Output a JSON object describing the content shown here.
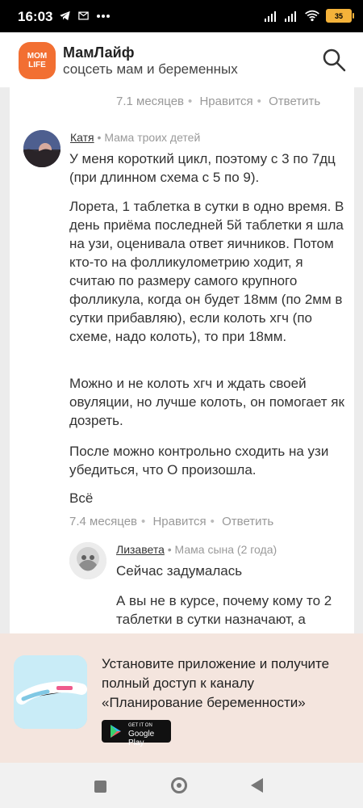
{
  "status_bar": {
    "time": "16:03",
    "left_icons": [
      "telegram-icon",
      "mail-icon",
      "more-dots-icon"
    ],
    "battery": "35"
  },
  "header": {
    "logo_line1": "MOM",
    "logo_line2": "LIFE",
    "title": "МамЛайф",
    "subtitle": "соцсеть мам и беременных"
  },
  "comments": {
    "top_meta": {
      "time": "7.1 месяцев",
      "like": "Нравится",
      "reply": "Ответить"
    },
    "katya": {
      "name": "Катя",
      "role": "Мама троих детей",
      "p1": "У меня короткий цикл, поэтому с 3 по 7дц (при длинном схема с 5 по 9).",
      "p2": "Лорета, 1 таблетка в сутки в одно время. В день приёма последней 5й таблетки я шла на узи, оценивала ответ яичников. Потом кто-то на фолликулометрию ходит, я считаю по размеру самого крупного фолликула, когда он будет 18мм (по 2мм в сутки прибавляю), если колоть хгч (по схеме, надо колоть), то при 18мм.",
      "p3": "Можно и не колоть хгч и ждать своей овуляции, но лучше колоть, он помогает як дозреть.",
      "p4": "После можно контрольно сходить на узи убедиться, что О произошла.",
      "p5": "Всё",
      "meta": {
        "time": "7.4 месяцев",
        "like": "Нравится",
        "reply": "Ответить"
      }
    },
    "lizaveta": {
      "name": "Лизавета",
      "role": "Мама сына (2 года)",
      "p1": "Сейчас задумалась",
      "p2": "А вы не в курсе, почему кому то 2 таблетки в сутки назначают, а"
    }
  },
  "banner": {
    "text": "Установите приложение и получите полный доступ к каналу «Планирование беременности»",
    "store_small": "GET IT ON",
    "store_big": "Google Play"
  },
  "nav": {
    "recent": "recent-apps",
    "home": "home",
    "back": "back"
  }
}
